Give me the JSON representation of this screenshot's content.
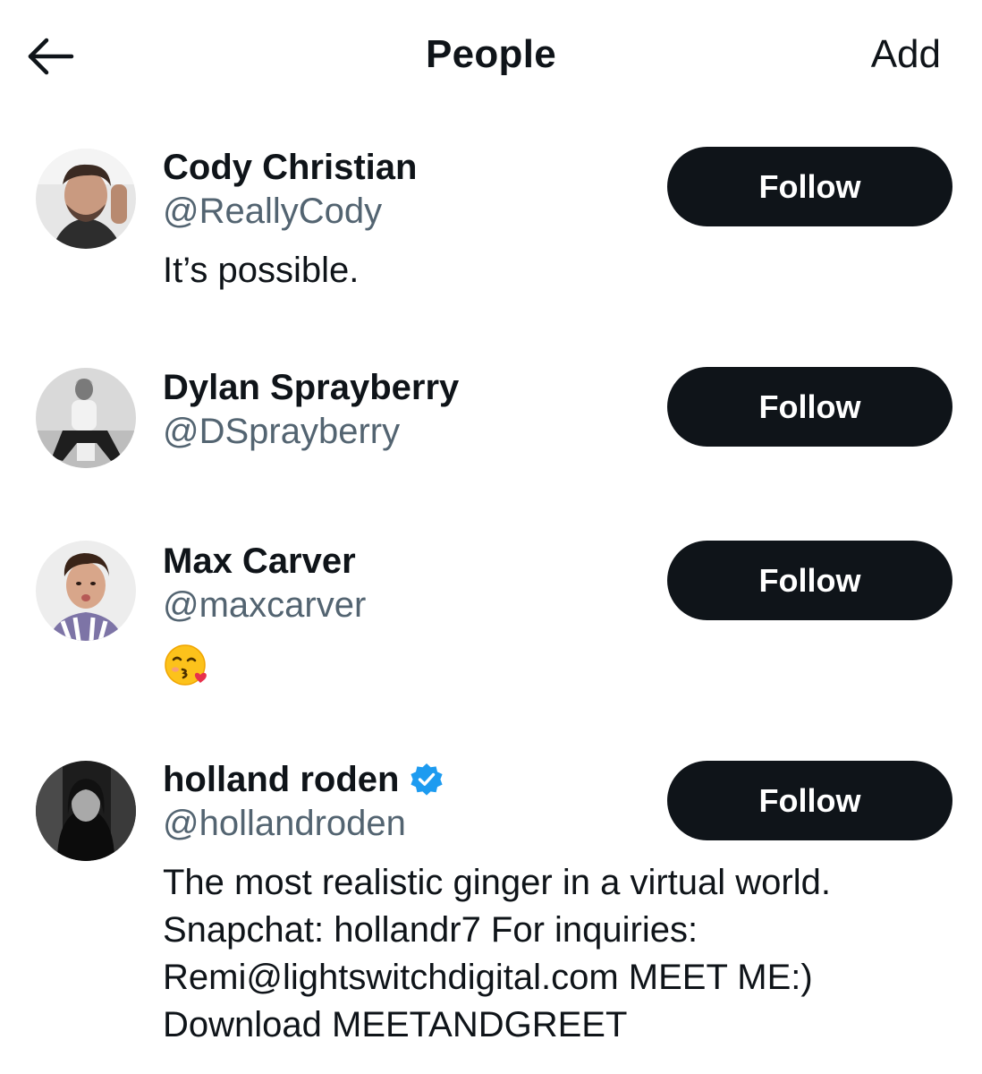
{
  "header": {
    "back_icon": "arrow-left-icon",
    "title": "People",
    "add_label": "Add"
  },
  "people": [
    {
      "name": "Cody Christian",
      "handle": "@ReallyCody",
      "bio": [
        "It’s possible."
      ],
      "verified": false,
      "follow_label": "Follow"
    },
    {
      "name": "Dylan Sprayberry",
      "handle": "@DSprayberry",
      "bio": [],
      "verified": false,
      "follow_label": "Follow"
    },
    {
      "name": "Max Carver",
      "handle": "@maxcarver",
      "bio_emoji": "kissing-face-with-heart-emoji",
      "verified": false,
      "follow_label": "Follow"
    },
    {
      "name": "holland roden",
      "handle": "@hollandroden",
      "bio": [
        "The most realistic ginger in a virtual world.",
        "Snapchat: hollandr7 For inquiries:",
        "Remi@lightswitchdigital.com MEET ME:)",
        "Download MEETANDGREET"
      ],
      "verified": true,
      "verified_icon": "verified-badge-icon",
      "follow_label": "Follow"
    }
  ],
  "colors": {
    "text_primary": "#0f1419",
    "text_secondary": "#536471",
    "button_bg": "#0f1419",
    "button_text": "#ffffff",
    "verified_blue": "#1d9bf0"
  }
}
